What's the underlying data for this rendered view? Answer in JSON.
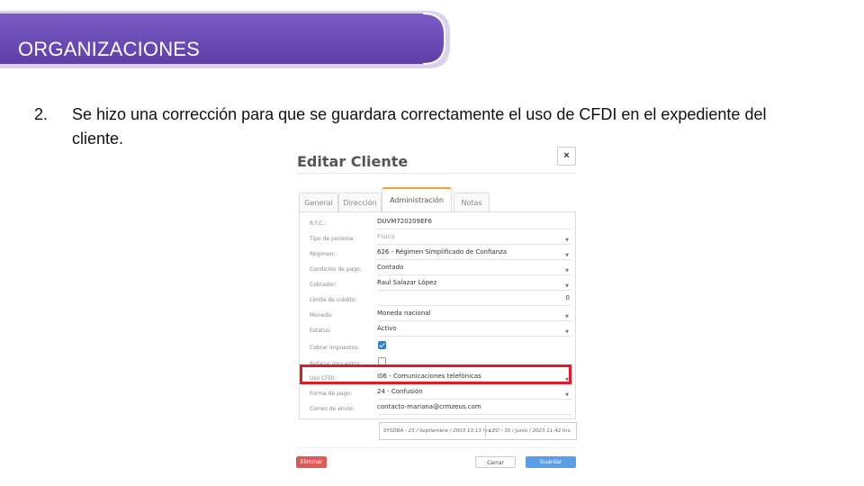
{
  "slide": {
    "title": "ORGANIZACIONES",
    "point_number": "2.",
    "point_text": "Se hizo una corrección para que se guardara correctamente el uso de CFDI en el expediente del cliente.",
    "banner_color": "#6a4bb5",
    "highlight_color": "#e0192b"
  },
  "modal": {
    "title": "Editar Cliente",
    "close_label": "×",
    "tabs": [
      {
        "label": "General"
      },
      {
        "label": "Dirección"
      },
      {
        "label": "Administración",
        "active": true
      },
      {
        "label": "Notas"
      }
    ],
    "fields": [
      {
        "label": "R.F.C.:",
        "value": "DUVM720209EF6"
      },
      {
        "label": "Tipo de persona:",
        "value": "Física"
      },
      {
        "label": "Régimen:",
        "value": "626 - Régimen Simplificado de Confianza"
      },
      {
        "label": "Condición de pago:",
        "value": "Contado"
      },
      {
        "label": "Cobrador:",
        "value": "Raul Salazar López"
      },
      {
        "label": "Límite de crédito:",
        "value": "0"
      },
      {
        "label": "Moneda:",
        "value": "Moneda nacional"
      },
      {
        "label": "Estatus:",
        "value": "Activo"
      },
      {
        "label": "Cobrar impuestos:",
        "checked": true
      },
      {
        "label": "Retiene impuestos:",
        "checked": false
      },
      {
        "label": "Uso CFDI:",
        "value": "I06 - Comunicaciones telefónicas"
      },
      {
        "label": "Forma de pago:",
        "value": "24 - Confusión"
      },
      {
        "label": "Correo de envío:",
        "value": "contacto-mariana@crmzeus.com"
      }
    ],
    "audit": {
      "created": "SYSDBA - 23 / Septiembre / 2003 13:13 hrs.",
      "modified": "LEO - 30 / Junio / 2023 11:42 hrs."
    },
    "buttons": {
      "delete": "Eliminar",
      "close": "Cerrar",
      "save": "Guardar"
    }
  }
}
